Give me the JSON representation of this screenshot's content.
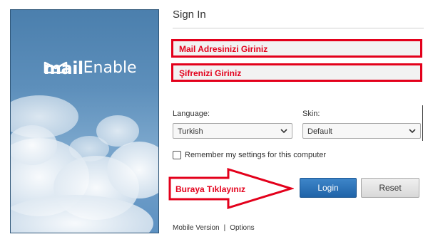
{
  "logo": {
    "part1": "mail",
    "part2": "Enable"
  },
  "signin": {
    "title": "Sign In",
    "email_annotation": "Mail Adresinizi Giriniz",
    "password_annotation": "Şifrenizi Giriniz",
    "language_label": "Language:",
    "language_value": "Turkish",
    "skin_label": "Skin:",
    "skin_value": "Default",
    "remember_label": "Remember my settings for this computer",
    "login_label": "Login",
    "reset_label": "Reset",
    "arrow_annotation": "Buraya Tıklayınız",
    "mobile_link": "Mobile Version",
    "separator": "|",
    "options_link": "Options"
  },
  "colors": {
    "annotation": "#e3001b",
    "login_button": "#2a72b8"
  }
}
